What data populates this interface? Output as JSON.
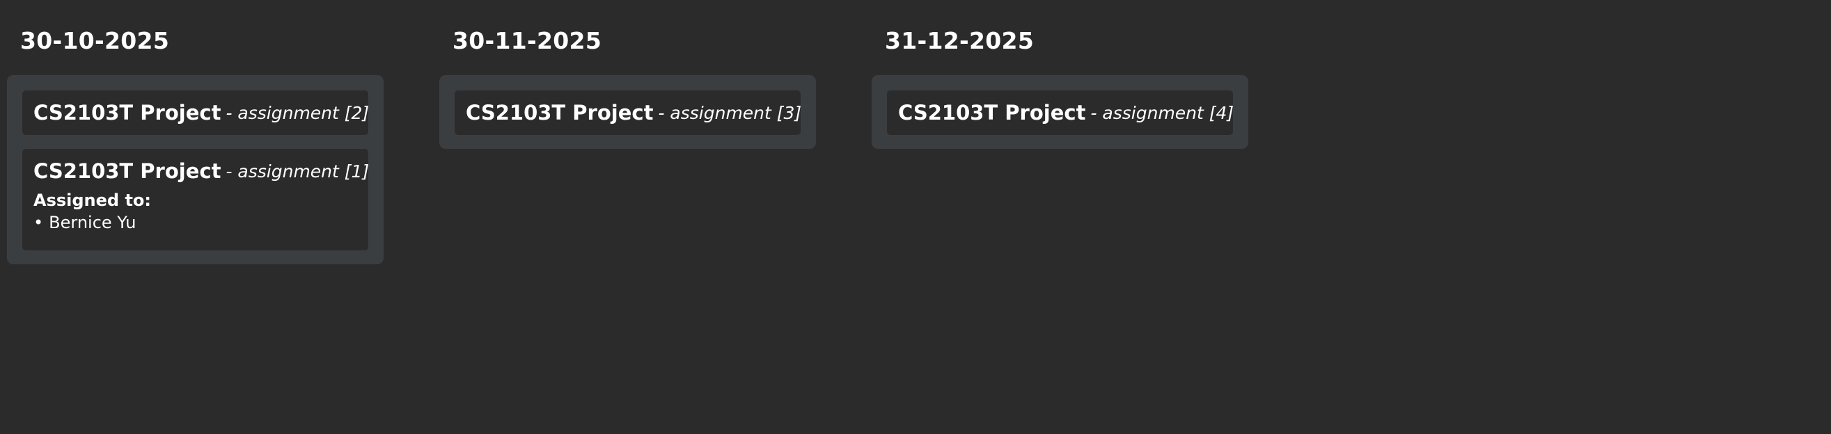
{
  "columns": [
    {
      "date": "30-10-2025",
      "cards": [
        {
          "project": "CS2103T Project",
          "assignment": "- assignment [2]"
        },
        {
          "project": "CS2103T Project",
          "assignment": "- assignment [1]",
          "assigned_label": "Assigned to:",
          "assignees": [
            "Bernice Yu"
          ],
          "bullet": "•"
        }
      ]
    },
    {
      "date": "30-11-2025",
      "cards": [
        {
          "project": "CS2103T Project",
          "assignment": "- assignment [3]"
        }
      ]
    },
    {
      "date": "31-12-2025",
      "cards": [
        {
          "project": "CS2103T Project",
          "assignment": "- assignment [4]"
        }
      ]
    }
  ],
  "colors": {
    "background": "#2b2b2b",
    "panel": "#3b3e41",
    "card": "#2b2b2b",
    "text": "#ffffff"
  }
}
